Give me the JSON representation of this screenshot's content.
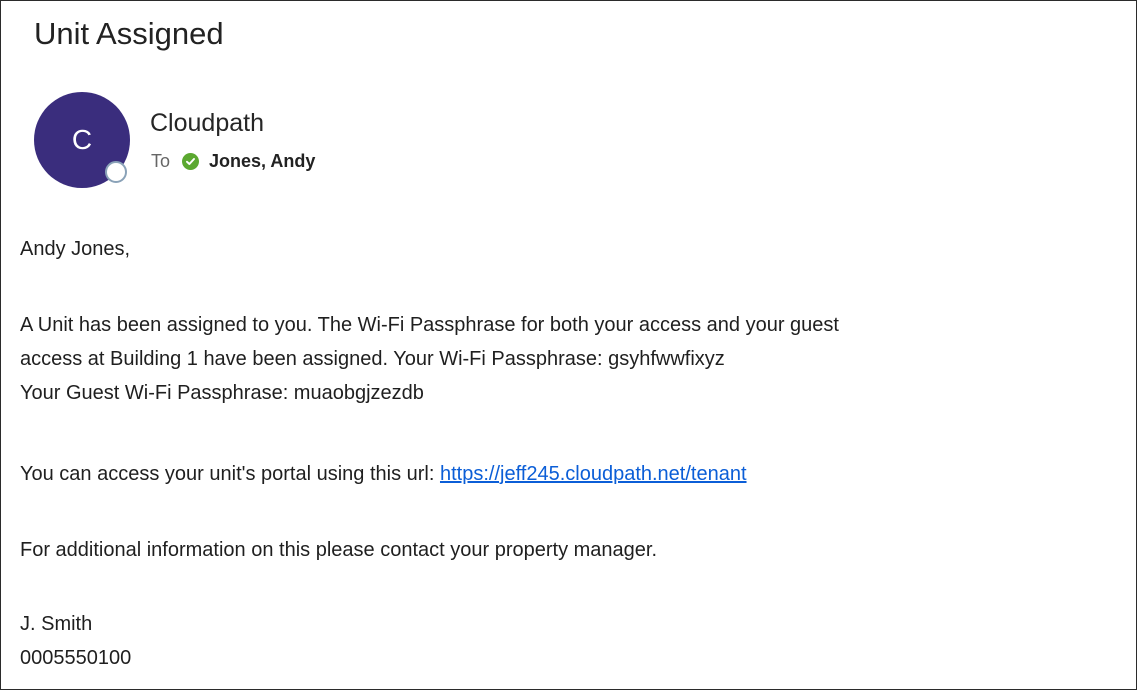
{
  "email": {
    "subject": "Unit Assigned",
    "sender": {
      "name": "Cloudpath",
      "initial": "C",
      "avatar_color": "#3a2d7d"
    },
    "to_label": "To",
    "recipient": "Jones, Andy",
    "body": {
      "greeting": "Andy Jones,",
      "paragraph1_line1": "A Unit has been assigned to you. The Wi-Fi Passphrase for both your access and your guest",
      "paragraph1_line2": "access at Building 1 have been assigned. Your Wi-Fi Passphrase: gsyhfwwfixyz",
      "paragraph1_line3": "Your Guest Wi-Fi Passphrase: muaobgjzezdb",
      "portal_text": "You can access your unit's portal using this url: ",
      "portal_url": "https://jeff245.cloudpath.net/tenant",
      "contact_text": "For additional information on this please contact your property manager.",
      "signature_name": "J. Smith",
      "signature_phone": "0005550100"
    }
  },
  "icons": {
    "presence": "presence-status-icon",
    "recipient_status": "check-circle-icon"
  },
  "colors": {
    "link": "#0b5ed7",
    "check_green": "#5ba830"
  }
}
